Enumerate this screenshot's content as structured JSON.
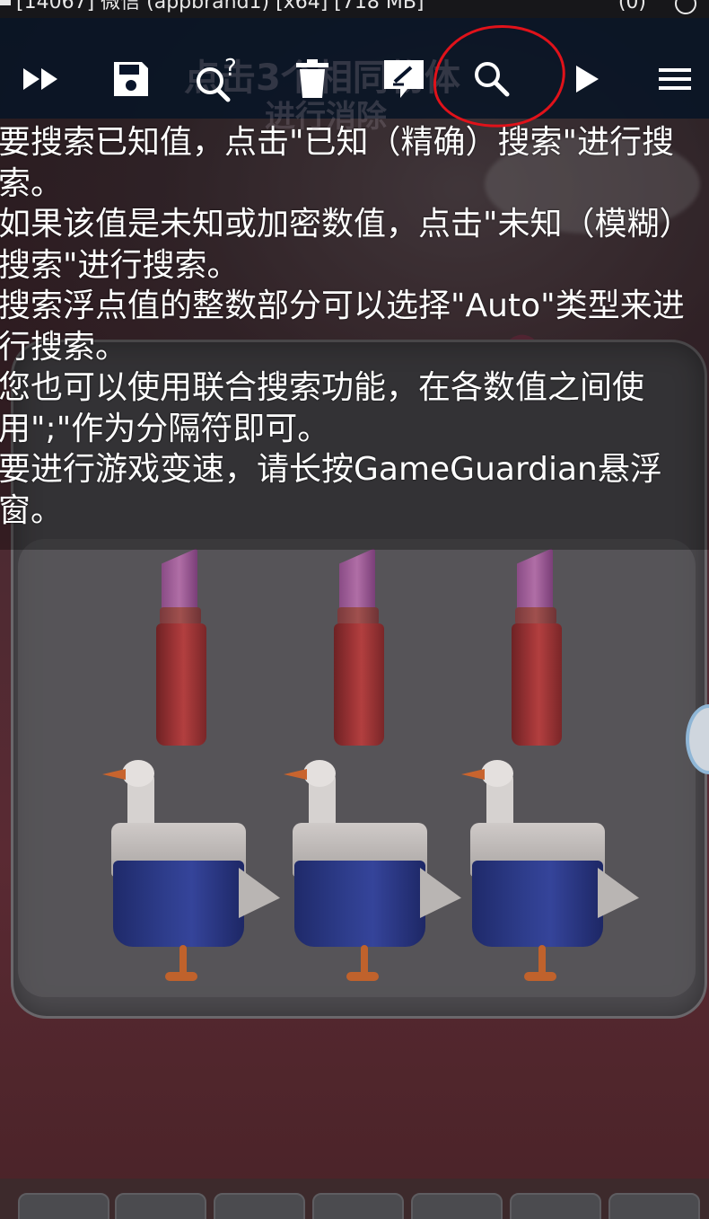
{
  "status_bar": {
    "left_text": "[14067] 微信 (appbrand1) [x64] [718 MB]",
    "right_text": "(0)"
  },
  "toolbar": {
    "ghost_text_line1": "点击3个相同物体",
    "ghost_text_line2": "进行消除",
    "buttons": [
      {
        "name": "speedhack-button",
        "icon": "fast-forward-icon"
      },
      {
        "name": "save-button",
        "icon": "save-icon"
      },
      {
        "name": "fuzzy-search-button",
        "icon": "search-question-icon"
      },
      {
        "name": "delete-button",
        "icon": "trash-icon"
      },
      {
        "name": "edit-button",
        "icon": "edit-icon"
      },
      {
        "name": "search-button",
        "icon": "search-icon",
        "highlighted": true
      },
      {
        "name": "play-button",
        "icon": "play-icon"
      },
      {
        "name": "menu-button",
        "icon": "menu-icon"
      }
    ],
    "highlight_color": "#e0121a"
  },
  "help": {
    "lines": [
      "要搜索已知值，点击\"已知（精确）搜索\"进行搜索。",
      "如果该值是未知或加密数值，点击\"未知（模糊）搜索\"进行搜索。",
      "搜索浮点值的整数部分可以选择\"Auto\"类型来进行搜索。",
      "您也可以使用联合搜索功能，在各数值之间使用\";\"作为分隔符即可。",
      "要进行游戏变速，请长按GameGuardian悬浮窗。"
    ]
  },
  "colors": {
    "toolbar_bg": "#08142a",
    "text": "#ffffff"
  }
}
